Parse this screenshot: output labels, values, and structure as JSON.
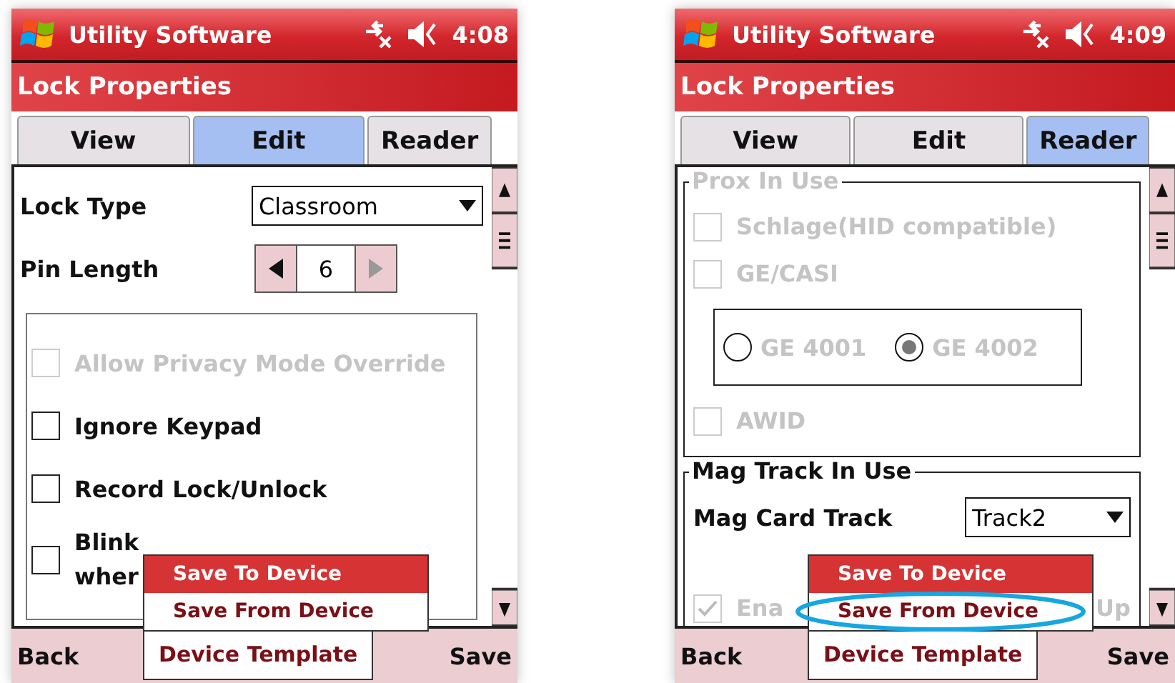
{
  "screens": [
    {
      "status": {
        "app": "Utility Software",
        "time": "4:08"
      },
      "title": "Lock Properties",
      "tabs": [
        {
          "label": "View",
          "selected": false
        },
        {
          "label": "Edit",
          "selected": true
        },
        {
          "label": "Reader",
          "selected": false
        }
      ],
      "content": [
        {
          "kind": "dropdown",
          "label": "Lock Type",
          "value": "Classroom"
        },
        {
          "kind": "spinner",
          "label": "Pin Length",
          "value": "6",
          "decrease_disabled": false,
          "increase_disabled": true
        },
        {
          "kind": "box",
          "children": [
            {
              "kind": "checkbox",
              "label": "Allow Privacy Mode Override",
              "checked": false,
              "disabled": true
            },
            {
              "kind": "checkbox",
              "label": "Ignore Keypad",
              "checked": false,
              "disabled": false
            },
            {
              "kind": "checkbox",
              "label": "Record Lock/Unlock",
              "checked": false,
              "disabled": false
            },
            {
              "kind": "checkbox",
              "label": "Blink",
              "label_2": "wher",
              "checked": false,
              "disabled": false
            }
          ]
        }
      ],
      "menu": [
        {
          "label": "Save To Device",
          "selected": true,
          "circled": false
        },
        {
          "label": "Save From Device",
          "selected": false,
          "circled": false
        }
      ],
      "softkeys": {
        "left": "Back",
        "center": "Device Template",
        "right": "Save"
      }
    },
    {
      "status": {
        "app": "Utility Software",
        "time": "4:09"
      },
      "title": "Lock Properties",
      "tabs": [
        {
          "label": "View",
          "selected": false
        },
        {
          "label": "Edit",
          "selected": false
        },
        {
          "label": "Reader",
          "selected": true
        }
      ],
      "content": [
        {
          "kind": "group",
          "legend": "Prox In Use",
          "disabled": true,
          "children": [
            {
              "kind": "checkbox",
              "label": "Schlage(HID compatible)",
              "checked": false,
              "disabled": true
            },
            {
              "kind": "checkbox",
              "label": "GE/CASI",
              "checked": false,
              "disabled": true
            },
            {
              "kind": "radios",
              "disabled": true,
              "options": [
                {
                  "label": "GE 4001",
                  "selected": false
                },
                {
                  "label": "GE 4002",
                  "selected": true
                }
              ]
            },
            {
              "kind": "checkbox",
              "label": "AWID",
              "checked": false,
              "disabled": true
            }
          ]
        },
        {
          "kind": "group",
          "legend": "Mag Track In Use",
          "disabled": false,
          "children": [
            {
              "kind": "dropdown",
              "label": "Mag Card Track",
              "value": "Track2"
            },
            {
              "kind": "checkbox",
              "label": "Ena",
              "label_end": "Up",
              "checked": true,
              "disabled": true
            }
          ]
        }
      ],
      "menu": [
        {
          "label": "Save To Device",
          "selected": true,
          "circled": false
        },
        {
          "label": "Save From Device",
          "selected": false,
          "circled": true
        }
      ],
      "softkeys": {
        "left": "Back",
        "center": "Device Template",
        "right": "Save"
      }
    }
  ]
}
